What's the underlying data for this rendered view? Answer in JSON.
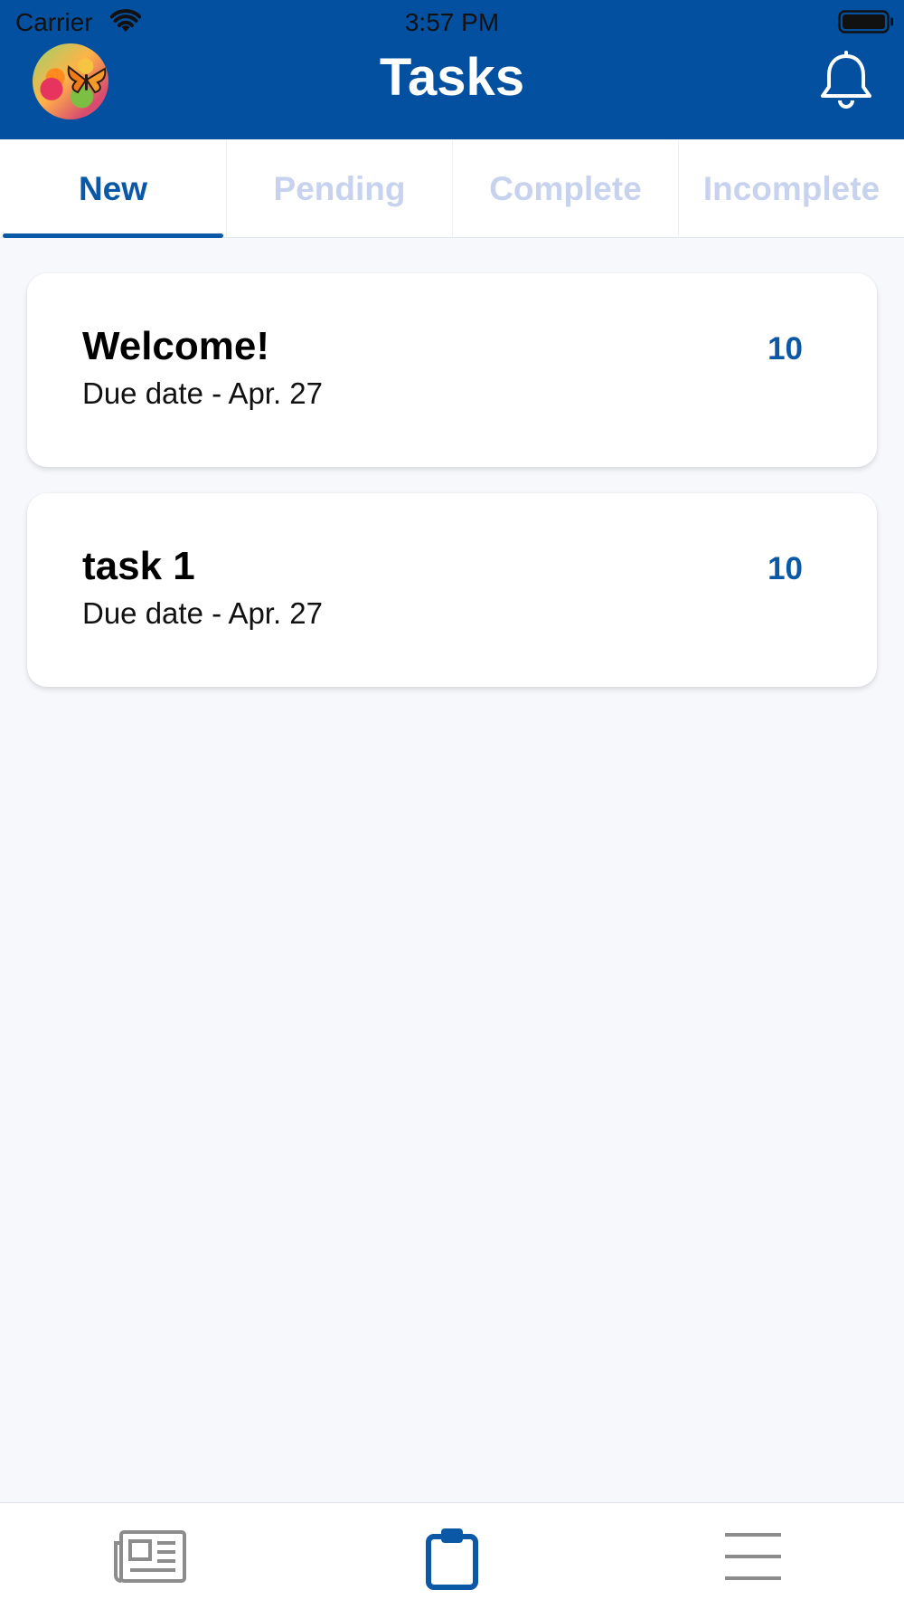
{
  "status_bar": {
    "carrier": "Carrier",
    "time": "3:57 PM"
  },
  "header": {
    "title": "Tasks",
    "avatar_icon": "butterfly-flower-avatar",
    "notification_icon": "bell-icon",
    "background_color": "#02509f"
  },
  "tabs": [
    {
      "label": "New",
      "active": true
    },
    {
      "label": "Pending",
      "active": false
    },
    {
      "label": "Complete",
      "active": false
    },
    {
      "label": "Incomplete",
      "active": false
    }
  ],
  "tasks": [
    {
      "title": "Welcome!",
      "due": "Due date - Apr. 27",
      "points": "10"
    },
    {
      "title": "task 1",
      "due": "Due date - Apr. 27",
      "points": "10"
    }
  ],
  "bottom_nav": {
    "items": [
      {
        "name": "news",
        "icon": "newspaper-icon",
        "active": false
      },
      {
        "name": "tasks",
        "icon": "clipboard-icon",
        "active": true
      },
      {
        "name": "menu",
        "icon": "hamburger-menu-icon",
        "active": false
      }
    ],
    "active_color": "#0a58a6",
    "inactive_color": "#8c8c8c"
  },
  "colors": {
    "accent": "#0a58a6",
    "inactive_tab": "#c7d2ef",
    "background": "#f7f8fc"
  }
}
